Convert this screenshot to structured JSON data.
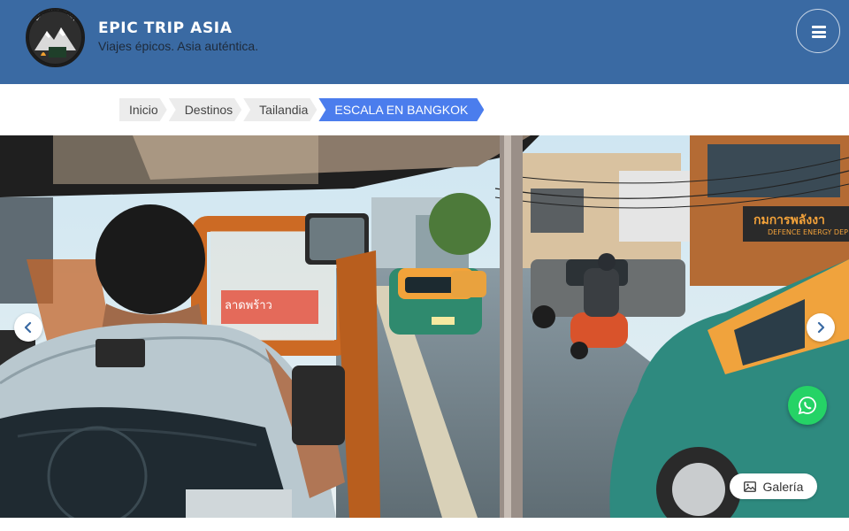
{
  "header": {
    "logo_text": "EPICTRIP ASIA",
    "title": "EPIC TRIP ASIA",
    "tagline": "Viajes épicos. Asia auténtica.",
    "menu_icon": "hamburger-menu-icon",
    "background_color": "#3a6aa3"
  },
  "breadcrumb": {
    "items": [
      {
        "label": "Inicio"
      },
      {
        "label": "Destinos"
      },
      {
        "label": "Tailandia"
      },
      {
        "label": "ESCALA EN BANGKOK"
      }
    ],
    "active_color": "#4b7ded"
  },
  "hero": {
    "image_alt": "Bangkok street from tuk-tuk",
    "sign_text": "กมการพลังงา",
    "sign_subtext": "DEFENCE ENERGY DEP",
    "prev_icon": "chevron-left-icon",
    "next_icon": "chevron-right-icon"
  },
  "whatsapp": {
    "icon": "whatsapp-icon",
    "color": "#25d366"
  },
  "gallery": {
    "label": "Galería",
    "icon": "image-icon"
  }
}
